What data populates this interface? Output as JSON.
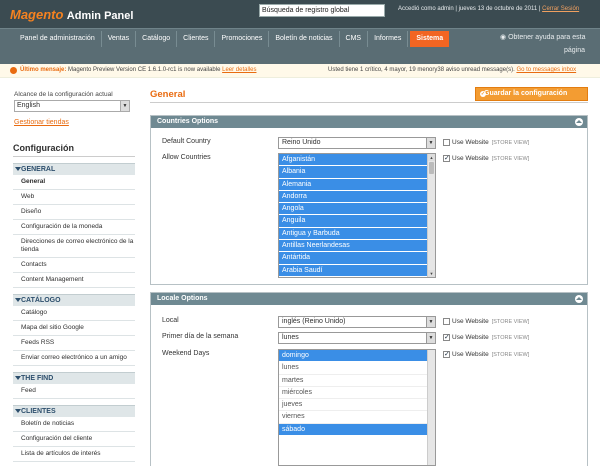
{
  "header": {
    "brand": "Magento",
    "title": "Admin Panel",
    "search_value": "Búsqueda de registro global",
    "user_text": "Accedió como admin  |  jueves 13 de octubre de 2011  |",
    "logout": "Cerrar Sesión"
  },
  "nav": {
    "items": [
      "Panel de administración",
      "Ventas",
      "Catálogo",
      "Clientes",
      "Promociones",
      "Boletín de noticias",
      "CMS",
      "Informes",
      "Sistema"
    ],
    "help_line1": "Obtener ayuda para esta",
    "help_line2": "página"
  },
  "notice": {
    "label": "Último mensaje:",
    "text": "Magento Preview Version CE 1.6.1.0-rc1 is now available",
    "link": "Leer detalles",
    "right_text": "Usted tiene 1 crítico, 4 mayor, 19 menory38 aviso unread message(s).",
    "right_link": "Go to messages inbox"
  },
  "scope": {
    "label": "Alcance de la configuración actual",
    "value": "English",
    "manage": "Gestionar tiendas"
  },
  "sidebar": {
    "title": "Configuración",
    "groups": [
      {
        "label": "GENERAL",
        "items": [
          "General",
          "Web",
          "Diseño",
          "Configuración de la moneda",
          "Direcciones de correo electrónico de la tienda",
          "Contacts",
          "Content Management"
        ]
      },
      {
        "label": "CATÁLOGO",
        "items": [
          "Catálogo",
          "Mapa del sitio Google",
          "Feeds RSS",
          "Enviar correo electrónico a un amigo"
        ]
      },
      {
        "label": "THE FIND",
        "items": [
          "Feed"
        ]
      },
      {
        "label": "CLIENTES",
        "items": [
          "Boletín de noticias",
          "Configuración del cliente",
          "Lista de artículos de interés"
        ]
      }
    ]
  },
  "main": {
    "title": "General",
    "save": "Guardar la configuración",
    "countries": {
      "title": "Countries Options",
      "default_label": "Default Country",
      "default_value": "Reino Unido",
      "allow_label": "Allow Countries",
      "allow_options": [
        "Afganistán",
        "Albania",
        "Alemania",
        "Andorra",
        "Angola",
        "Anguila",
        "Antigua y Barbuda",
        "Antillas Neerlandesas",
        "Antártida",
        "Arabia Saudí"
      ]
    },
    "locale": {
      "title": "Locale Options",
      "locale_label": "Local",
      "locale_value": "inglés (Reino Unido)",
      "firstday_label": "Primer día de la semana",
      "firstday_value": "lunes",
      "weekend_label": "Weekend Days",
      "weekend_options": [
        "domingo",
        "lunes",
        "martes",
        "miércoles",
        "jueves",
        "viernes",
        "sábado"
      ]
    },
    "use_website": "Use Website",
    "store_view": "[STORE VIEW]"
  }
}
